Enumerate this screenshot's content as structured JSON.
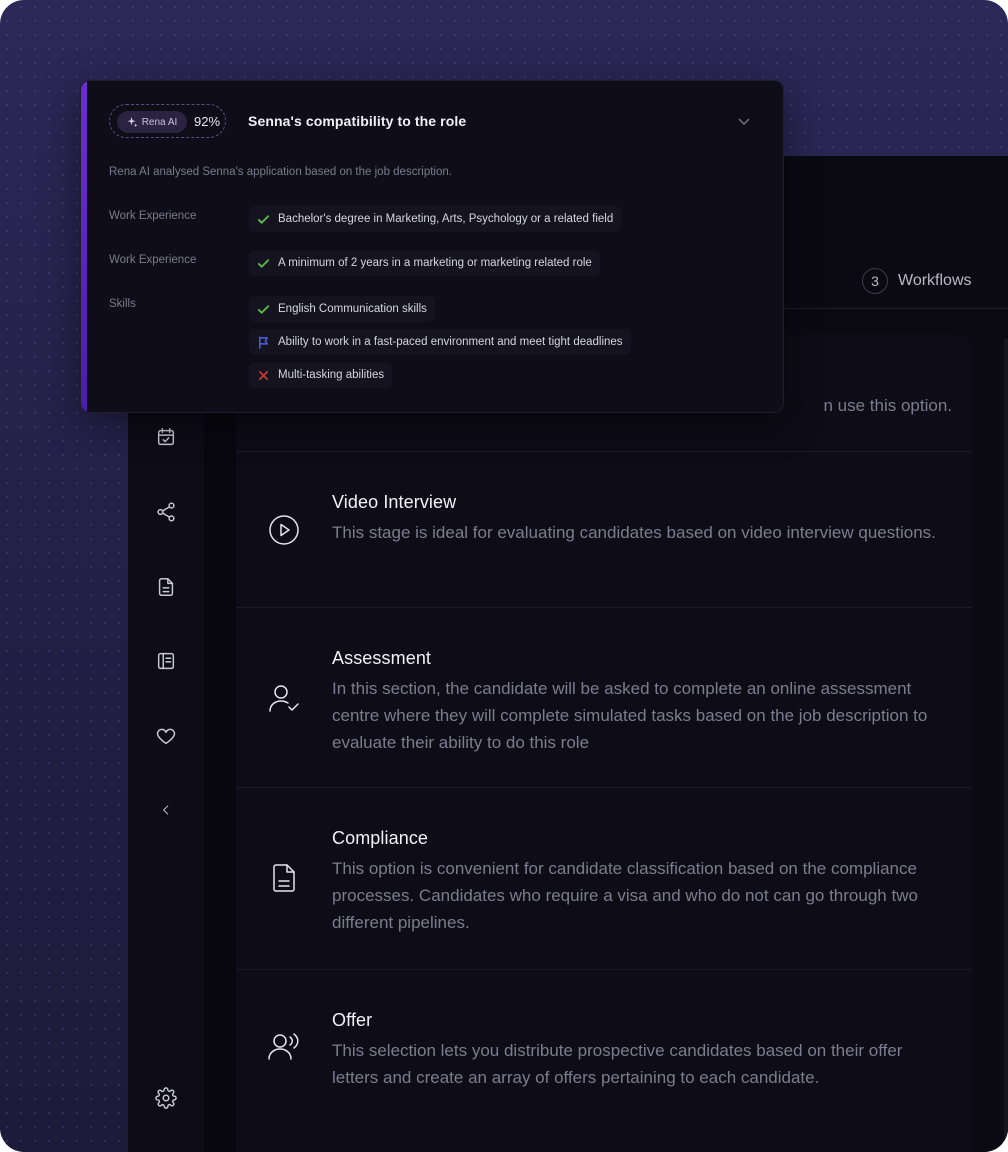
{
  "colors": {
    "background": "#221f45",
    "accent": "#6b2fd1",
    "check": "#57c04a",
    "flag": "#4a62e6",
    "cross": "#d23a36"
  },
  "sidebar": {
    "icons": [
      {
        "name": "calendar-check-icon"
      },
      {
        "name": "share-icon"
      },
      {
        "name": "document-icon"
      },
      {
        "name": "notebook-icon"
      },
      {
        "name": "heart-icon"
      },
      {
        "name": "chevron-left-icon"
      },
      {
        "name": "settings-icon"
      }
    ]
  },
  "header": {
    "workflows_count": "3",
    "workflows_label": "Workflows"
  },
  "stages": {
    "partial_desc": "n use this option.",
    "items": [
      {
        "title": "Video Interview",
        "desc": "This stage is ideal for evaluating candidates based on video interview questions.",
        "icon": "play-circle-icon"
      },
      {
        "title": "Assessment",
        "desc": "In this section, the candidate will be asked to complete an online assessment centre where they will complete simulated tasks based on the job description to evaluate their ability to do this role",
        "icon": "user-check-icon"
      },
      {
        "title": "Compliance",
        "desc": "This option is convenient for candidate classification based on the compliance processes. Candidates who require a visa and who do not can go through two different pipelines.",
        "icon": "file-text-icon"
      },
      {
        "title": "Offer",
        "desc": "This selection lets you distribute prospective candidates based on their offer letters and create an array of offers pertaining to each candidate.",
        "icon": "user-voice-icon"
      }
    ]
  },
  "compatibility": {
    "badge_label": "Rena AI",
    "score": "92%",
    "title": "Senna's compatibility to the role",
    "subtitle": "Rena AI analysed  Senna's application based on the job description.",
    "rows": [
      {
        "label": "Work Experience",
        "items": [
          {
            "status": "check",
            "text": "Bachelor's degree in Marketing, Arts, Psychology or a related field"
          }
        ]
      },
      {
        "label": "Work Experience",
        "items": [
          {
            "status": "check",
            "text": "A minimum of 2 years in a marketing or marketing related role"
          }
        ]
      },
      {
        "label": "Skills",
        "items": [
          {
            "status": "check",
            "text": "English Communication skills"
          },
          {
            "status": "flag",
            "text": "Ability to work in a fast-paced environment and meet tight deadlines"
          },
          {
            "status": "cross",
            "text": "Multi-tasking abilities"
          }
        ]
      }
    ]
  }
}
